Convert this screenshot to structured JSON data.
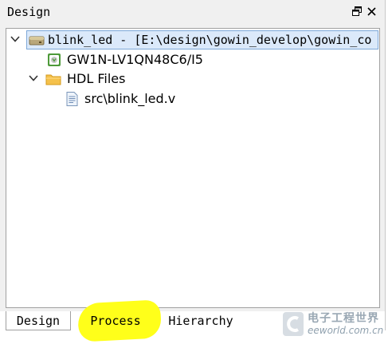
{
  "panel": {
    "title": "Design",
    "float_icon": "float-window-icon",
    "close_icon": "close-icon"
  },
  "tree": {
    "project": {
      "label": "blink_led - [E:\\design\\gowin_develop\\gowin_co",
      "icon": "project-drive-icon",
      "expanded": true,
      "selected": true
    },
    "device": {
      "label": "GW1N-LV1QN48C6/I5",
      "icon": "chip-device-icon"
    },
    "hdl_folder": {
      "label": "HDL Files",
      "icon": "folder-icon",
      "expanded": true
    },
    "file": {
      "label": "src\\blink_led.v",
      "icon": "verilog-file-icon"
    }
  },
  "tabs": [
    {
      "label": "Design",
      "active": true
    },
    {
      "label": "Process",
      "active": false,
      "highlighted": true
    },
    {
      "label": "Hierarchy",
      "active": false
    }
  ],
  "watermark": {
    "cn_text": "电子工程世界",
    "url": "eeworld.com.cn"
  },
  "colors": {
    "selection_bg": "#dbe9fa",
    "selection_border": "#7ea8d8",
    "highlight": "#ffff1a",
    "folder": "#f5c14b"
  }
}
